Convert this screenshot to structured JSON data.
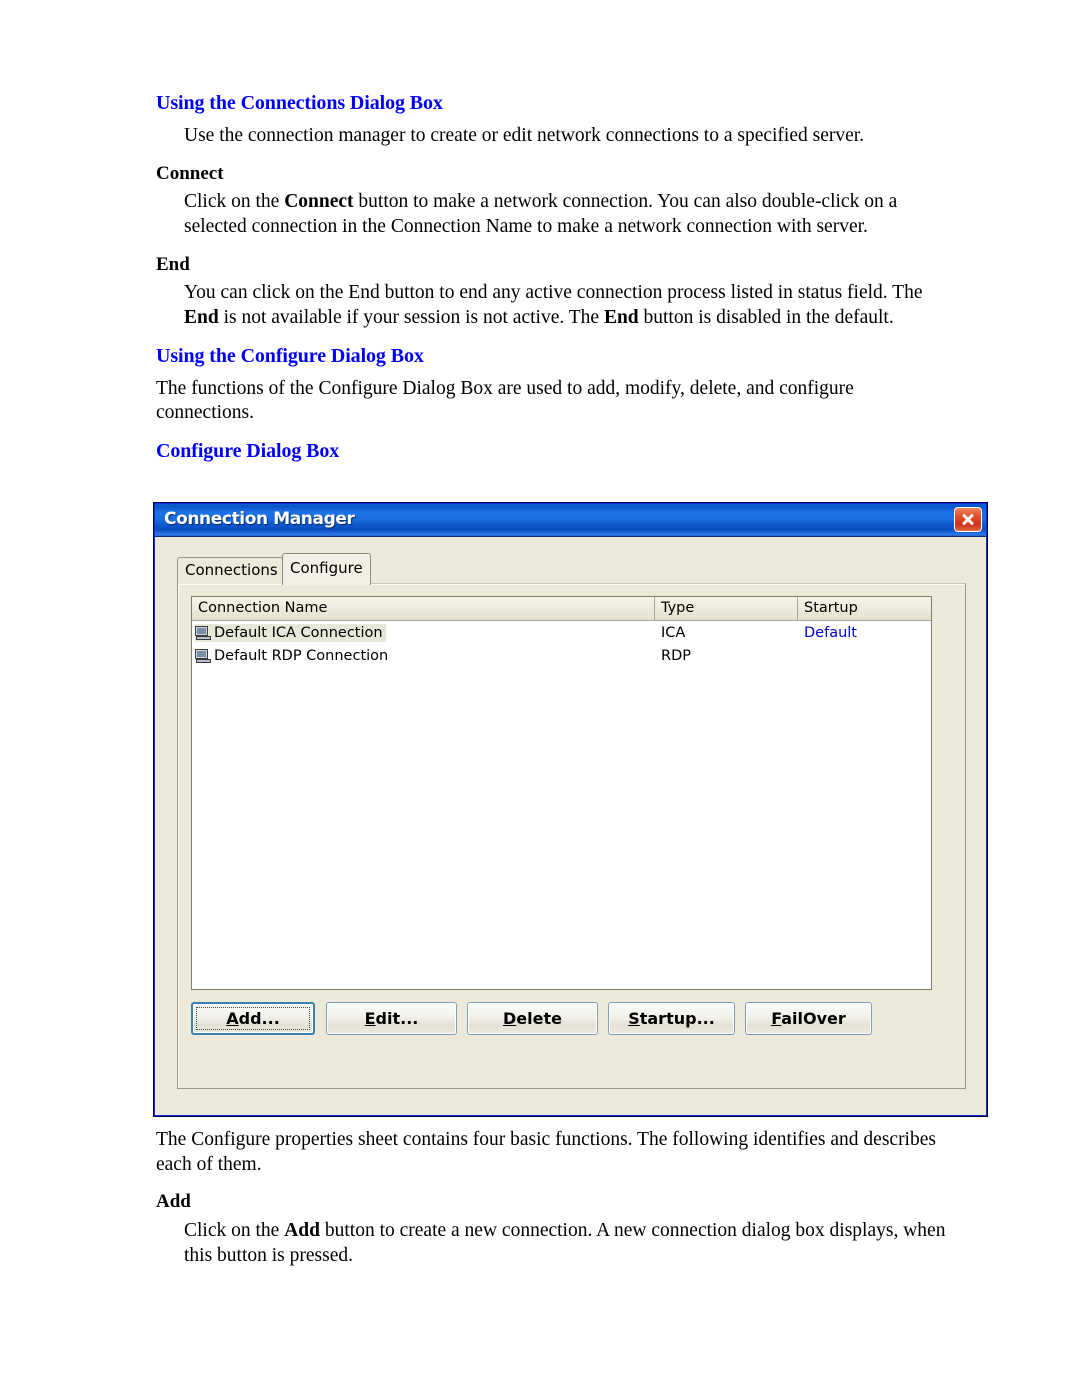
{
  "document": {
    "sections": [
      {
        "heading": "Using the Connections Dialog Box",
        "intro": "Use the connection manager to create or edit network connections to a specified server."
      },
      {
        "subheading_connect": "Connect",
        "connect_text_1": "Click on the ",
        "connect_bold": "Connect",
        "connect_text_2": " button to make a network connection. You can also double-click on a selected connection in the Connection Name to make a network connection with server."
      },
      {
        "subheading_end": "End",
        "end_text_1": "You can click on the End button to end any active connection process listed in status field.  The ",
        "end_bold_1": "End",
        "end_text_2": " is not available if your session is not active.  The ",
        "end_bold_2": "End",
        "end_text_3": " button is disabled in the default."
      },
      {
        "heading_configure": "Using the Configure Dialog Box",
        "configure_text": "The functions of the Configure Dialog Box are used to add, modify, delete, and configure connections."
      },
      {
        "heading_figure": "Configure Dialog Box"
      }
    ],
    "after_figure": {
      "paragraph": "The Configure properties sheet contains four basic functions. The following identifies and describes each of them.",
      "subheading_add": "Add",
      "add_text_1": "Click on the ",
      "add_bold": "Add",
      "add_text_2": " button to create a new connection. A new connection dialog box displays, when this button is pressed."
    }
  },
  "dialog": {
    "title": "Connection Manager",
    "close_label": "x",
    "tabs": [
      {
        "label": "Connections",
        "active": false
      },
      {
        "label": "Configure",
        "active": true
      }
    ],
    "listview": {
      "columns": [
        "Connection Name",
        "Type",
        "Startup"
      ],
      "rows": [
        {
          "name": "Default ICA Connection",
          "type": "ICA",
          "startup": "Default",
          "selected": true
        },
        {
          "name": "Default RDP Connection",
          "type": "RDP",
          "startup": "",
          "selected": false
        }
      ]
    },
    "buttons": [
      {
        "accel": "A",
        "rest": "dd...",
        "default": true
      },
      {
        "accel": "E",
        "rest": "dit...",
        "default": false
      },
      {
        "accel": "D",
        "rest": "elete",
        "default": false
      },
      {
        "accel": "S",
        "rest": "tartup...",
        "default": false
      },
      {
        "accel": "F",
        "rest": "ailOver",
        "default": false
      }
    ]
  },
  "colors": {
    "heading_blue": "#0000ff",
    "titlebar_blue": "#1b6de0",
    "close_red": "#d3421f",
    "dialog_face": "#ece9d8",
    "startup_link_blue": "#0000cc"
  }
}
